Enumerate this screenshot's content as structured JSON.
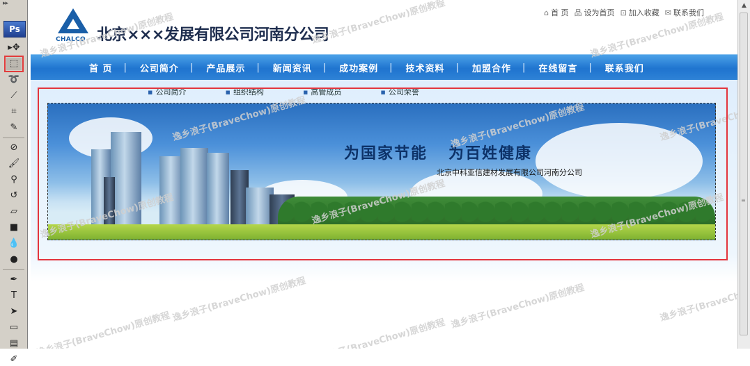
{
  "photoshop": {
    "logo": "Ps",
    "tools": [
      {
        "name": "move-tool",
        "icon": "move-icon",
        "glyph": "▸✥"
      },
      {
        "name": "marquee-tool",
        "icon": "rectangular-marquee-icon",
        "glyph": "⬚",
        "active": true
      },
      {
        "name": "lasso-tool",
        "icon": "lasso-icon",
        "glyph": "➰"
      },
      {
        "name": "magic-wand-tool",
        "icon": "magic-wand-icon",
        "glyph": "⟋"
      },
      {
        "name": "crop-tool",
        "icon": "crop-icon",
        "glyph": "⌗"
      },
      {
        "name": "eyedropper-tool",
        "icon": "eyedropper-icon",
        "glyph": "✎"
      },
      {
        "name": "healing-brush-tool",
        "icon": "bandage-icon",
        "glyph": "⊘"
      },
      {
        "name": "brush-tool",
        "icon": "brush-icon",
        "glyph": "🖌"
      },
      {
        "name": "clone-stamp-tool",
        "icon": "stamp-icon",
        "glyph": "⚲"
      },
      {
        "name": "history-brush-tool",
        "icon": "history-brush-icon",
        "glyph": "↺"
      },
      {
        "name": "eraser-tool",
        "icon": "eraser-icon",
        "glyph": "▱"
      },
      {
        "name": "gradient-tool",
        "icon": "gradient-icon",
        "glyph": "■"
      },
      {
        "name": "blur-tool",
        "icon": "blur-drop-icon",
        "glyph": "💧"
      },
      {
        "name": "dodge-tool",
        "icon": "dodge-icon",
        "glyph": "●"
      },
      {
        "name": "pen-tool",
        "icon": "pen-icon",
        "glyph": "✒"
      },
      {
        "name": "type-tool",
        "icon": "type-icon",
        "glyph": "T"
      },
      {
        "name": "path-selection-tool",
        "icon": "path-arrow-icon",
        "glyph": "➤"
      },
      {
        "name": "shape-tool",
        "icon": "rectangle-shape-icon",
        "glyph": "▭"
      },
      {
        "name": "notes-tool",
        "icon": "notes-icon",
        "glyph": "▤"
      },
      {
        "name": "eyedropper2-tool",
        "icon": "eyedropper-icon",
        "glyph": "✐"
      }
    ]
  },
  "site": {
    "logo_text": "CHALCO",
    "title": "北京×××发展有限公司河南分公司",
    "top_links": [
      {
        "icon": "home-icon",
        "glyph": "⌂",
        "label": "首 页"
      },
      {
        "icon": "sitemap-icon",
        "glyph": "品",
        "label": "设为首页"
      },
      {
        "icon": "bookmark-icon",
        "glyph": "⊡",
        "label": "加入收藏"
      },
      {
        "icon": "mail-icon",
        "glyph": "✉",
        "label": "联系我们"
      }
    ],
    "nav": [
      "首 页",
      "公司简介",
      "产品展示",
      "新闻资讯",
      "成功案例",
      "技术资料",
      "加盟合作",
      "在线留言",
      "联系我们"
    ],
    "subnav": [
      "公司简介",
      "组织结构",
      "高管成员",
      "公司荣誉"
    ],
    "banner": {
      "slogan_left": "为国家节能",
      "slogan_right": "为百姓健康",
      "sub": "北京中科亚信建材发展有限公司河南分公司"
    }
  },
  "watermark": "逸乡浪子(BraveChow)原创教程"
}
